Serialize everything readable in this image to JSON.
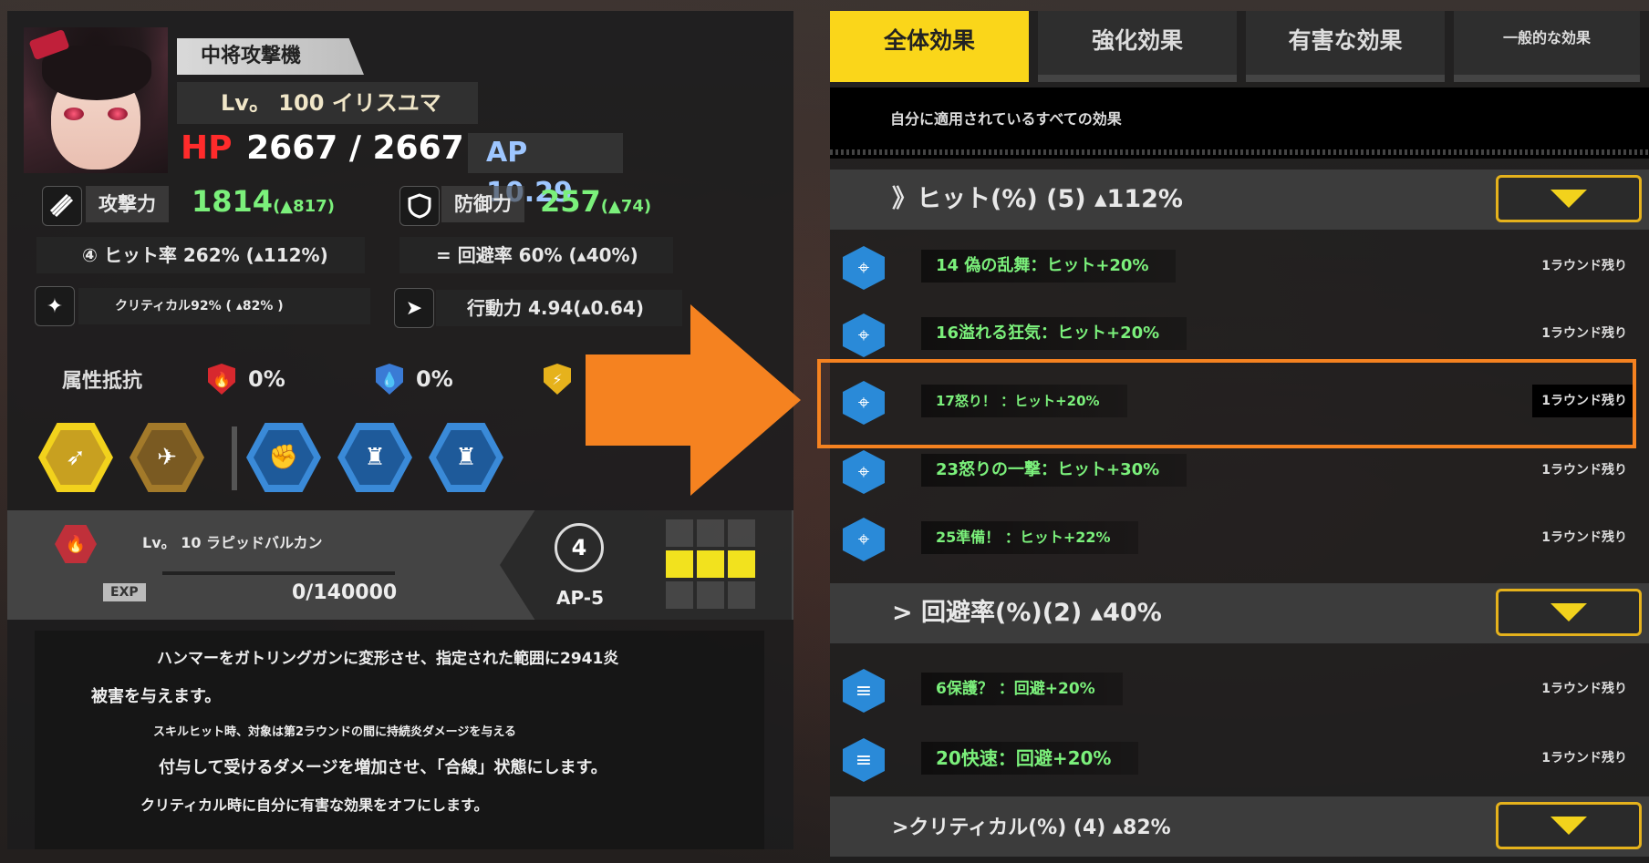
{
  "character": {
    "rank": "中将攻撃機",
    "level_name": "Lv。 100 イリスユマ",
    "hp_label": "HP",
    "hp_value": "2667 / 2667",
    "ap": "AP 10.29"
  },
  "stats": {
    "attack_label": "攻撃力",
    "attack_value": "1814",
    "attack_bonus": "(▲817)",
    "defense_label": "防御力",
    "defense_value": "257",
    "defense_bonus": "(▲74)",
    "hit_rate": "④ ヒット率 262% (▴112%)",
    "evasion": "= 回避率 60% (▴40%)",
    "crit": "クリティカル92% ( ▴82% )",
    "mobility": "行動力 4.94(▴0.64)"
  },
  "resist": {
    "label": "属性抵抗",
    "fire": "0%",
    "water": "0%"
  },
  "skill": {
    "name": "Lv。 10 ラピッドバルカン",
    "exp_label": "EXP",
    "exp_value": "0/140000",
    "range": "4",
    "ap_cost": "AP-5"
  },
  "description": {
    "line1": "ハンマーをガトリングガンに変形させ、指定された範囲に2941炎",
    "line2": "被害を与えます。",
    "line3": "スキルヒット時、対象は第2ラウンドの間に持続炎ダメージを与える",
    "line4": "付与して受けるダメージを増加させ、「合線」状態にします。",
    "line5": "クリティカル時に自分に有害な効果をオフにします。"
  },
  "tabs": {
    "all": "全体効果",
    "buff": "強化効果",
    "debuff": "有害な効果",
    "general": "一般的な効果"
  },
  "subtitle": "自分に適用されているすべての効果",
  "categories": {
    "hit": "》ヒット(%) (5) ▴112%",
    "evade": "> 回避率(%)(2) ▴40%",
    "crit": ">クリティカル(%) (4) ▴82%"
  },
  "effects": [
    {
      "label": "14 偽の乱舞：ヒット+20%",
      "duration": "1ラウンド残り"
    },
    {
      "label": "16溢れる狂気：ヒット+20%",
      "duration": "1ラウンド残り"
    },
    {
      "label": "17怒り！ ：ヒット+20%",
      "duration": "1ラウンド残り"
    },
    {
      "label": "23怒りの一撃：ヒット+30%",
      "duration": "1ラウンド残り"
    },
    {
      "label": "25準備！ ：ヒット+22%",
      "duration": "1ラウンド残り"
    },
    {
      "label": "6保護？ ：回避+20%",
      "duration": "1ラウンド残り"
    },
    {
      "label": "20快速：回避+20%",
      "duration": "1ラウンド残り"
    }
  ],
  "colors": {
    "accent": "#fad61a",
    "highlight": "#f58220",
    "positive": "#7bf07b",
    "hp": "#ff2b2b"
  }
}
